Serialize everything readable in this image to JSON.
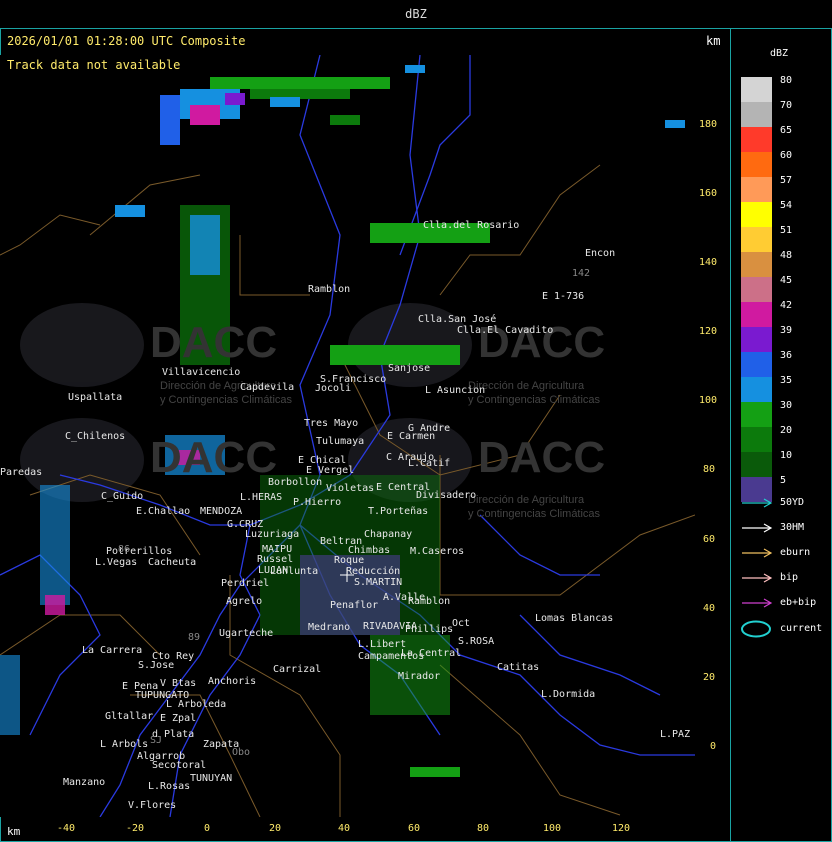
{
  "header": {
    "unit_title": "dBZ",
    "timestamp": "2026/01/01 01:28:00 UTC Composite",
    "km_top": "km",
    "track_message": "Track data not available",
    "km_bottom": "km"
  },
  "axes": {
    "y_ticks": [
      "180",
      "160",
      "140",
      "120",
      "100",
      "80",
      "60",
      "40",
      "20",
      "0"
    ],
    "x_ticks": [
      "-40",
      "-20",
      "0",
      "20",
      "40",
      "60",
      "80",
      "100",
      "120"
    ]
  },
  "legend": {
    "title": "dBZ",
    "scale": [
      {
        "value": "80",
        "color": "#d4d4d4"
      },
      {
        "value": "70",
        "color": "#b4b4b4"
      },
      {
        "value": "65",
        "color": "#ff3a2a"
      },
      {
        "value": "60",
        "color": "#ff6a10"
      },
      {
        "value": "57",
        "color": "#ff9a58"
      },
      {
        "value": "54",
        "color": "#ffff00"
      },
      {
        "value": "51",
        "color": "#ffcc33"
      },
      {
        "value": "48",
        "color": "#d99040"
      },
      {
        "value": "45",
        "color": "#cc7088"
      },
      {
        "value": "42",
        "color": "#d01aa0"
      },
      {
        "value": "39",
        "color": "#7a1ad0"
      },
      {
        "value": "36",
        "color": "#2060e8"
      },
      {
        "value": "35",
        "color": "#1590e0"
      },
      {
        "value": "30",
        "color": "#14a014"
      },
      {
        "value": "20",
        "color": "#0c7a0c"
      },
      {
        "value": "10",
        "color": "#0a5a0a"
      },
      {
        "value": "5",
        "color": "#4a3a90"
      }
    ],
    "tracks": [
      {
        "label": "50YD",
        "color": "#22d0d0"
      },
      {
        "label": "30HM",
        "color": "#ffffff"
      },
      {
        "label": "eburn",
        "color": "#f0c060"
      },
      {
        "label": "bip",
        "color": "#ffc0c0"
      },
      {
        "label": "eb+bip",
        "color": "#d040d0"
      }
    ],
    "current_label": "current",
    "current_color": "#22d0d0"
  },
  "watermark": {
    "brand": "DACC",
    "line1": "Dirección de Agricultura",
    "line2": "y Contingencias Climáticas"
  },
  "places": [
    {
      "name": "Clla.del Rosario"
    },
    {
      "name": "Encon"
    },
    {
      "name": "E 1-736"
    },
    {
      "name": "142"
    },
    {
      "name": "Ramblon"
    },
    {
      "name": "Clla.San José"
    },
    {
      "name": "Clla.El Cavadito"
    },
    {
      "name": "Villavicencio"
    },
    {
      "name": "Capdevila"
    },
    {
      "name": "S.Francisco"
    },
    {
      "name": "Sanjose"
    },
    {
      "name": "Uspallata"
    },
    {
      "name": "Jocoli"
    },
    {
      "name": "L Asuncion"
    },
    {
      "name": "Tres Mayo"
    },
    {
      "name": "C_Chilenos"
    },
    {
      "name": "Tulumaya"
    },
    {
      "name": "G Andre"
    },
    {
      "name": "E Carmen"
    },
    {
      "name": "E Chical"
    },
    {
      "name": "E Vergel"
    },
    {
      "name": "C Araujo"
    },
    {
      "name": "L.Catif"
    },
    {
      "name": "Paredas"
    },
    {
      "name": "Borbollon"
    },
    {
      "name": "Violetas"
    },
    {
      "name": "E Central"
    },
    {
      "name": "Divisadero"
    },
    {
      "name": "C_Guido"
    },
    {
      "name": "L.HERAS"
    },
    {
      "name": "P.Hierro"
    },
    {
      "name": "T.Porteñas"
    },
    {
      "name": "E.Challao"
    },
    {
      "name": "MENDOZA"
    },
    {
      "name": "G.CRUZ"
    },
    {
      "name": "Chapanay"
    },
    {
      "name": "Luzuriaga"
    },
    {
      "name": "Beltran"
    },
    {
      "name": "Chimbas"
    },
    {
      "name": "M.Caseros"
    },
    {
      "name": "Potrerillos"
    },
    {
      "name": "MAIPU"
    },
    {
      "name": "Russel"
    },
    {
      "name": "L.Vegas"
    },
    {
      "name": "Cacheuta"
    },
    {
      "name": "LUJAN"
    },
    {
      "name": "Lunlunta"
    },
    {
      "name": "Roque"
    },
    {
      "name": "S.MARTIN"
    },
    {
      "name": "Perdriel"
    },
    {
      "name": "Reducción"
    },
    {
      "name": "A.Valle"
    },
    {
      "name": "Ramblon"
    },
    {
      "name": "Agrelo"
    },
    {
      "name": "Penaflor"
    },
    {
      "name": "RIVADAVIA"
    },
    {
      "name": "Lomas Blancas"
    },
    {
      "name": "Medrano"
    },
    {
      "name": "Phillips"
    },
    {
      "name": "Ugarteche"
    },
    {
      "name": "Oct"
    },
    {
      "name": "S.ROSA"
    },
    {
      "name": "L.Libert"
    },
    {
      "name": "La Carrera"
    },
    {
      "name": "Cto Rey"
    },
    {
      "name": "Carrizal"
    },
    {
      "name": "Campamentos"
    },
    {
      "name": "S.Jose"
    },
    {
      "name": "La Central"
    },
    {
      "name": "Catitas"
    },
    {
      "name": "E Pena"
    },
    {
      "name": "V Btas"
    },
    {
      "name": "Anchoris"
    },
    {
      "name": "Mirador"
    },
    {
      "name": "TUPUNGATO"
    },
    {
      "name": "L.Dormida"
    },
    {
      "name": "L Arboleda"
    },
    {
      "name": "Gltallar"
    },
    {
      "name": "E Zpal"
    },
    {
      "name": "d Plata"
    },
    {
      "name": "L.PAZ"
    },
    {
      "name": "L Arbols"
    },
    {
      "name": "Zapata"
    },
    {
      "name": "Algarrob"
    },
    {
      "name": "Secotoral"
    },
    {
      "name": "TUNUYAN"
    },
    {
      "name": "Manzano"
    },
    {
      "name": "L.Rosas"
    },
    {
      "name": "V.Flores"
    },
    {
      "name": "Obo"
    },
    {
      "name": "SJ"
    },
    {
      "name": "86"
    },
    {
      "name": "89"
    }
  ]
}
